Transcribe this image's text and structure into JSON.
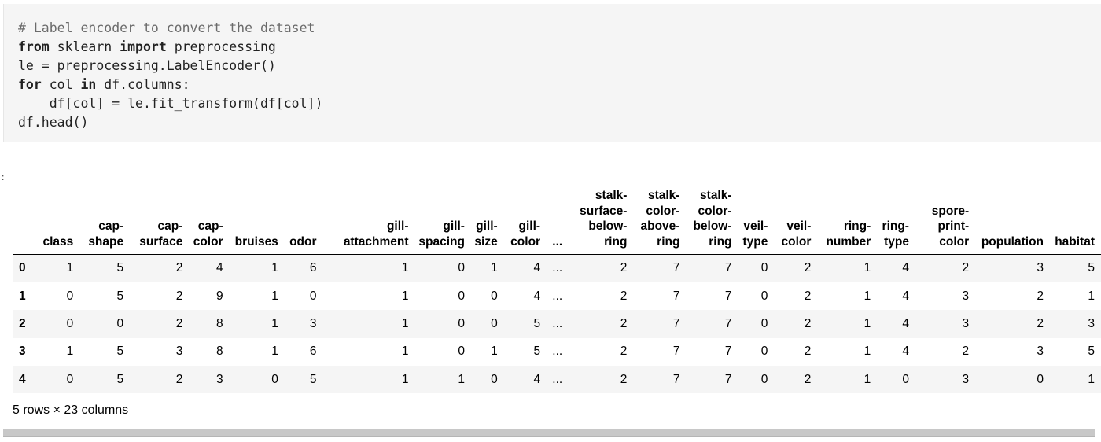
{
  "code_cell": {
    "lines": [
      [
        {
          "t": "# Label encoder to convert the dataset",
          "c": "cm"
        }
      ],
      [
        {
          "t": "from",
          "c": "kw"
        },
        {
          "t": " sklearn "
        },
        {
          "t": "import",
          "c": "kw"
        },
        {
          "t": " preprocessing"
        }
      ],
      [
        {
          "t": "le = preprocessing.LabelEncoder()"
        }
      ],
      [
        {
          "t": "for",
          "c": "kw"
        },
        {
          "t": " col "
        },
        {
          "t": "in",
          "c": "kw"
        },
        {
          "t": " df.columns:"
        }
      ],
      [
        {
          "t": "    df[col] = le.fit_transform(df[col])"
        }
      ],
      [
        {
          "t": "df.head()"
        }
      ]
    ]
  },
  "output": {
    "prompt": ":",
    "columns": [
      [
        "class"
      ],
      [
        "cap-",
        "shape"
      ],
      [
        "cap-",
        "surface"
      ],
      [
        "cap-",
        "color"
      ],
      [
        "bruises"
      ],
      [
        "odor"
      ],
      [
        "gill-",
        "attachment"
      ],
      [
        "gill-",
        "spacing"
      ],
      [
        "gill-",
        "size"
      ],
      [
        "gill-",
        "color"
      ],
      [
        "..."
      ],
      [
        "stalk-",
        "surface-",
        "below-",
        "ring"
      ],
      [
        "stalk-",
        "color-",
        "above-",
        "ring"
      ],
      [
        "stalk-",
        "color-",
        "below-",
        "ring"
      ],
      [
        "veil-",
        "type"
      ],
      [
        "veil-",
        "color"
      ],
      [
        "ring-",
        "number"
      ],
      [
        "ring-",
        "type"
      ],
      [
        "spore-",
        "print-",
        "color"
      ],
      [
        "population"
      ],
      [
        "habitat"
      ]
    ],
    "rows": [
      {
        "index": "0",
        "cells": [
          "1",
          "5",
          "2",
          "4",
          "1",
          "6",
          "1",
          "0",
          "1",
          "4",
          "...",
          "2",
          "7",
          "7",
          "0",
          "2",
          "1",
          "4",
          "2",
          "3",
          "5"
        ]
      },
      {
        "index": "1",
        "cells": [
          "0",
          "5",
          "2",
          "9",
          "1",
          "0",
          "1",
          "0",
          "0",
          "4",
          "...",
          "2",
          "7",
          "7",
          "0",
          "2",
          "1",
          "4",
          "3",
          "2",
          "1"
        ]
      },
      {
        "index": "2",
        "cells": [
          "0",
          "0",
          "2",
          "8",
          "1",
          "3",
          "1",
          "0",
          "0",
          "5",
          "...",
          "2",
          "7",
          "7",
          "0",
          "2",
          "1",
          "4",
          "3",
          "2",
          "3"
        ]
      },
      {
        "index": "3",
        "cells": [
          "1",
          "5",
          "3",
          "8",
          "1",
          "6",
          "1",
          "0",
          "1",
          "5",
          "...",
          "2",
          "7",
          "7",
          "0",
          "2",
          "1",
          "4",
          "2",
          "3",
          "5"
        ]
      },
      {
        "index": "4",
        "cells": [
          "0",
          "5",
          "2",
          "3",
          "0",
          "5",
          "1",
          "1",
          "0",
          "4",
          "...",
          "2",
          "7",
          "7",
          "0",
          "2",
          "1",
          "0",
          "3",
          "0",
          "1"
        ]
      }
    ],
    "shape_text": "5 rows × 23 columns"
  }
}
